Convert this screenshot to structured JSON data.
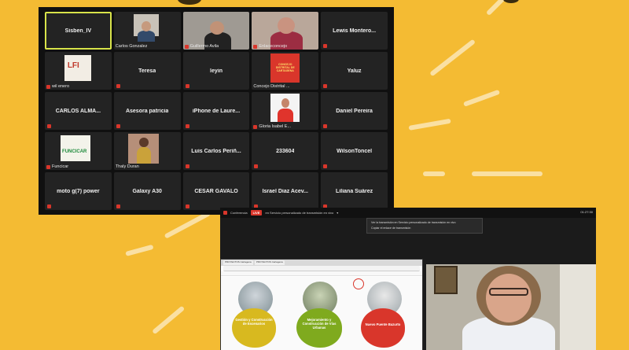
{
  "colors": {
    "background": "#f4bb33",
    "tile_bg": "#232323",
    "active_border": "#d8e34a",
    "mute_red": "#d9362b",
    "live_red": "#d9362b"
  },
  "gallery": {
    "tiles": [
      {
        "center": "Sisben_IV",
        "label": "",
        "active": true,
        "photo": false,
        "muted": false
      },
      {
        "center": "",
        "label": "Carlos Gonzalez",
        "active": false,
        "photo": true,
        "muted": false
      },
      {
        "center": "",
        "label": "Guillermo Avila",
        "active": false,
        "photo": true,
        "muted": true
      },
      {
        "center": "",
        "label": "Enlaceconcejo",
        "active": false,
        "photo": true,
        "muted": true
      },
      {
        "center": "Lewis Montero...",
        "label": "",
        "active": false,
        "photo": false,
        "muted": true
      },
      {
        "center": "",
        "label": "wil enero",
        "active": false,
        "photo": true,
        "muted": true
      },
      {
        "center": "Teresa",
        "label": "",
        "active": false,
        "photo": false,
        "muted": true
      },
      {
        "center": "leyin",
        "label": "",
        "active": false,
        "photo": false,
        "muted": true
      },
      {
        "center": "",
        "label": "Concejo Distrital ...",
        "active": false,
        "photo": true,
        "muted": false
      },
      {
        "center": "Yaluz",
        "label": "",
        "active": false,
        "photo": false,
        "muted": true
      },
      {
        "center": "CARLOS ALMA...",
        "label": "",
        "active": false,
        "photo": false,
        "muted": true
      },
      {
        "center": "Asesora patricia",
        "label": "",
        "active": false,
        "photo": false,
        "muted": true
      },
      {
        "center": "iPhone de Laure...",
        "label": "",
        "active": false,
        "photo": false,
        "muted": true
      },
      {
        "center": "",
        "label": "Gloria Isabel E...",
        "active": false,
        "photo": true,
        "muted": true
      },
      {
        "center": "Daniel Pereira",
        "label": "",
        "active": false,
        "photo": false,
        "muted": true
      },
      {
        "center": "",
        "label": "Funcicar",
        "active": false,
        "photo": true,
        "muted": true
      },
      {
        "center": "",
        "label": "Thaly Duran",
        "active": false,
        "photo": true,
        "muted": false
      },
      {
        "center": "Luis Carlos Periñ...",
        "label": "",
        "active": false,
        "photo": false,
        "muted": true
      },
      {
        "center": "233604",
        "label": "",
        "active": false,
        "photo": false,
        "muted": true
      },
      {
        "center": "WilsonToncel",
        "label": "",
        "active": false,
        "photo": false,
        "muted": true
      },
      {
        "center": "moto g(7) power",
        "label": "",
        "active": false,
        "photo": false,
        "muted": true
      },
      {
        "center": "Galaxy A30",
        "label": "",
        "active": false,
        "photo": false,
        "muted": true
      },
      {
        "center": "CESAR GAVALO",
        "label": "",
        "active": false,
        "photo": false,
        "muted": true
      },
      {
        "center": "Israel Diaz Acev...",
        "label": "",
        "active": false,
        "photo": false,
        "muted": true
      },
      {
        "center": "Liliana Suárez",
        "label": "",
        "active": false,
        "photo": false,
        "muted": true
      }
    ],
    "logos": {
      "lfi": "LFI",
      "concejo": "CONCEJO DISTRITAL DE CARTAGENA",
      "funcicar": "FUNCICAR"
    }
  },
  "stream": {
    "live_label": "LIVE",
    "source_label": "Conferencia",
    "service_label": "en Servicio personalizado de transmisión en vivo",
    "timer": "01:27:30",
    "popup_items": [
      "Ver la transmisión en Servicio personalizado de transmisión en vivo",
      "Copiar el enlace de transmisión"
    ],
    "browser_tabs": [
      "PROYECTOS Cartagena",
      "PROYECTOS Cartagena"
    ],
    "slide_captions": [
      "Gestión y Construcción de Escenarios",
      "Mejoramiento y Construcción de Vías Urbanas",
      "Nuevo Puente Bazurto"
    ]
  }
}
